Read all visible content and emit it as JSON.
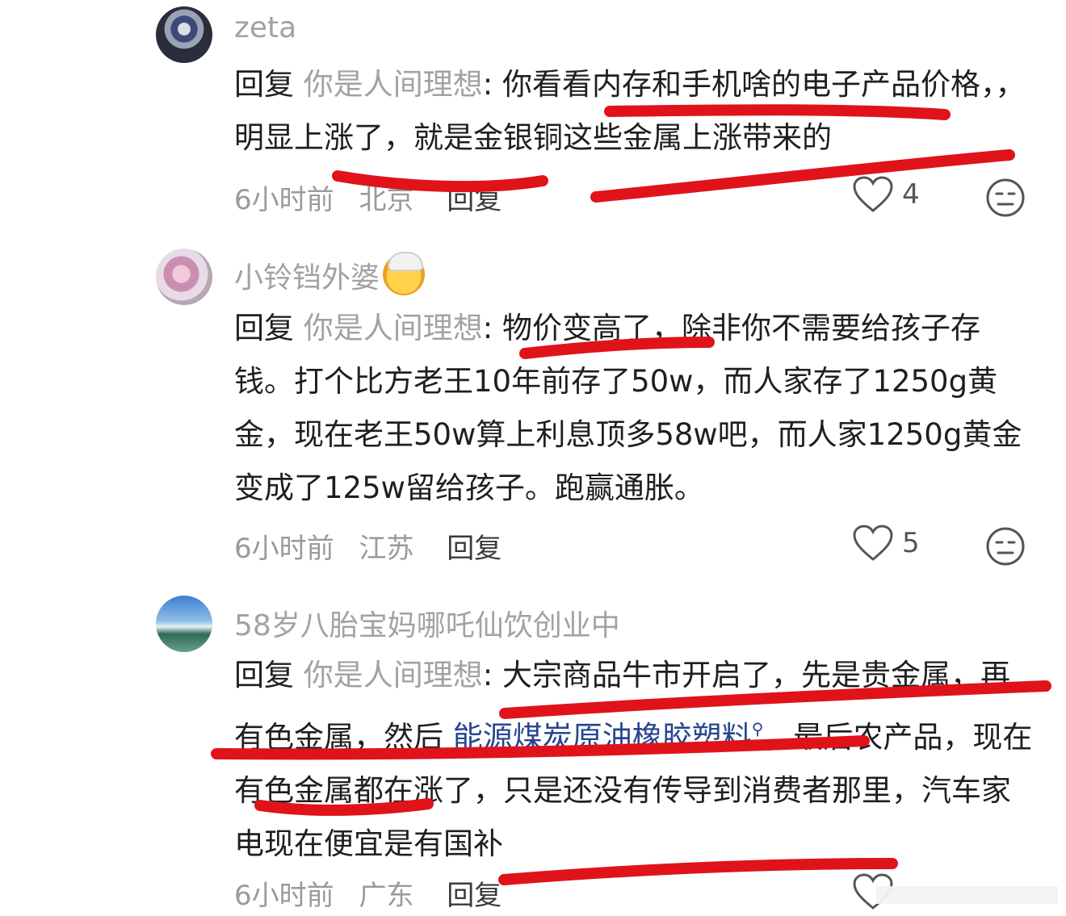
{
  "comments": [
    {
      "username": "zeta",
      "reply_prefix": "回复",
      "reply_target": "你是人间理想",
      "text": ": 你看看内存和手机啥的电子产品价格，，明显上涨了，就是金银铜这些金属上涨带来的",
      "time": "6小时前",
      "location": "北京",
      "reply_label": "回复",
      "likes": "4"
    },
    {
      "username": "小铃铛外婆",
      "reply_prefix": "回复",
      "reply_target": "你是人间理想",
      "text": ": 物价变高了，除非你不需要给孩子存钱。打个比方老王10年前存了50w，而人家存了1250g黄金，现在老王50w算上利息顶多58w吧，而人家1250g黄金变成了125w留给孩子。跑赢通胀。",
      "time": "6小时前",
      "location": "江苏",
      "reply_label": "回复",
      "likes": "5"
    },
    {
      "username": "58岁八胎宝妈哪吒仙饮创业中",
      "reply_prefix": "回复",
      "reply_target": "你是人间理想",
      "text_before_link": ": 大宗商品牛市开启了，先是贵金属，再有色金属，然后 ",
      "link_text": "能源煤炭原油橡胶塑料",
      "text_after_link": "，最后农产品，现在有色金属都在涨了，只是还没有传导到消费者那里，汽车家电现在便宜是有国补",
      "time": "6小时前",
      "location": "广东",
      "reply_label": "回复"
    }
  ],
  "colors": {
    "username": "#a2a2a2",
    "body_text": "#1f1f1f",
    "link": "#27458f",
    "meta": "#9a9a9a",
    "annotation_stroke": "#e0131b"
  }
}
